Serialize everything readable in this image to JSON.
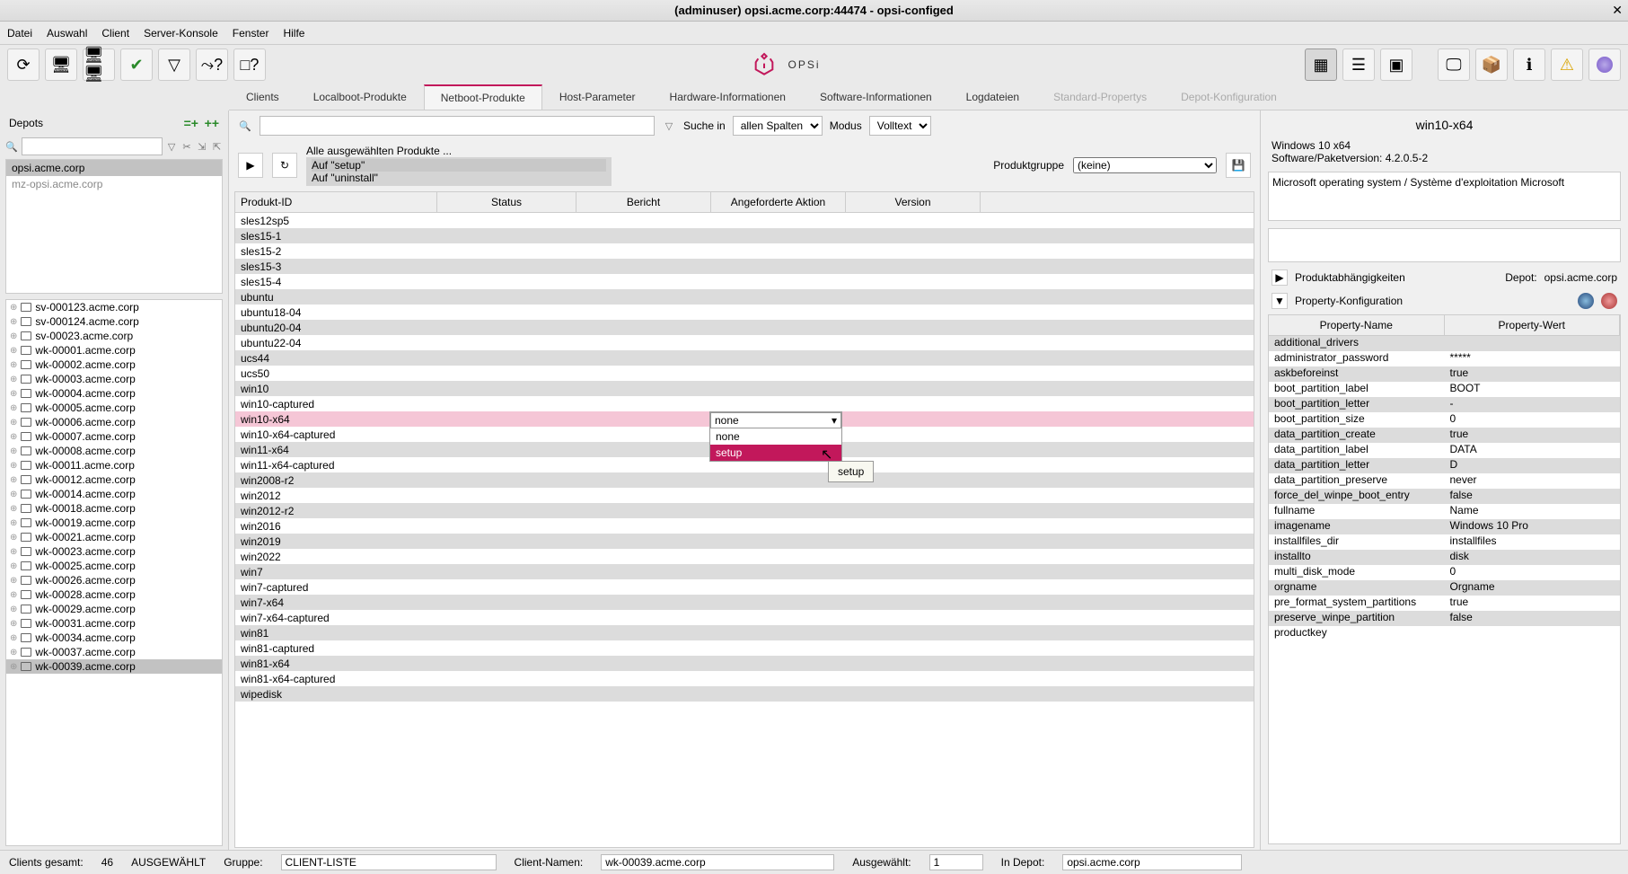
{
  "window_title": "(adminuser) opsi.acme.corp:44474 - opsi-configed",
  "menu": [
    "Datei",
    "Auswahl",
    "Client",
    "Server-Konsole",
    "Fenster",
    "Hilfe"
  ],
  "logo_text": "OPSi",
  "tabs": [
    {
      "label": "Clients",
      "active": false
    },
    {
      "label": "Localboot-Produkte",
      "active": false
    },
    {
      "label": "Netboot-Produkte",
      "active": true
    },
    {
      "label": "Host-Parameter",
      "active": false
    },
    {
      "label": "Hardware-Informationen",
      "active": false
    },
    {
      "label": "Software-Informationen",
      "active": false
    },
    {
      "label": "Logdateien",
      "active": false
    },
    {
      "label": "Standard-Propertys",
      "disabled": true
    },
    {
      "label": "Depot-Konfiguration",
      "disabled": true
    }
  ],
  "depots": {
    "label": "Depots",
    "items": [
      "opsi.acme.corp",
      "mz-opsi.acme.corp"
    ],
    "selected": 0
  },
  "clients": [
    "sv-000123.acme.corp",
    "sv-000124.acme.corp",
    "sv-00023.acme.corp",
    "wk-00001.acme.corp",
    "wk-00002.acme.corp",
    "wk-00003.acme.corp",
    "wk-00004.acme.corp",
    "wk-00005.acme.corp",
    "wk-00006.acme.corp",
    "wk-00007.acme.corp",
    "wk-00008.acme.corp",
    "wk-00011.acme.corp",
    "wk-00012.acme.corp",
    "wk-00014.acme.corp",
    "wk-00018.acme.corp",
    "wk-00019.acme.corp",
    "wk-00021.acme.corp",
    "wk-00023.acme.corp",
    "wk-00025.acme.corp",
    "wk-00026.acme.corp",
    "wk-00028.acme.corp",
    "wk-00029.acme.corp",
    "wk-00031.acme.corp",
    "wk-00034.acme.corp",
    "wk-00037.acme.corp",
    "wk-00039.acme.corp"
  ],
  "client_selected": 25,
  "search": {
    "suche_in": "Suche in",
    "spalten": "allen Spalten",
    "modus": "Modus",
    "modus_val": "Volltext"
  },
  "prodhead": {
    "all": "Alle ausgewählten Produkte ...",
    "setup": "Auf \"setup\"",
    "uninstall": "Auf \"uninstall\"",
    "pg": "Produktgruppe",
    "pg_val": "(keine)"
  },
  "cols": {
    "id": "Produkt-ID",
    "status": "Status",
    "bericht": "Bericht",
    "aktion": "Angeforderte Aktion",
    "version": "Version"
  },
  "rows": [
    "sles12sp5",
    "sles15-1",
    "sles15-2",
    "sles15-3",
    "sles15-4",
    "ubuntu",
    "ubuntu18-04",
    "ubuntu20-04",
    "ubuntu22-04",
    "ucs44",
    "ucs50",
    "win10",
    "win10-captured",
    "win10-x64",
    "win10-x64-captured",
    "win11-x64",
    "win11-x64-captured",
    "win2008-r2",
    "win2012",
    "win2012-r2",
    "win2016",
    "win2019",
    "win2022",
    "win7",
    "win7-captured",
    "win7-x64",
    "win7-x64-captured",
    "win81",
    "win81-captured",
    "win81-x64",
    "win81-x64-captured",
    "wipedisk"
  ],
  "row_selected": 13,
  "dropdown": {
    "current": "none",
    "opts": [
      "none",
      "setup"
    ],
    "hover": 1,
    "tooltip": "setup"
  },
  "right": {
    "title": "win10-x64",
    "name": "Windows 10 x64",
    "ver_label": "Software/Paketversion:",
    "ver": "4.2.0.5-2",
    "desc": "Microsoft operating system / Système d'exploitation Microsoft",
    "dep": "Produktabhängigkeiten",
    "depot_label": "Depot:",
    "depot": "opsi.acme.corp",
    "propconf": "Property-Konfiguration",
    "ph_name": "Property-Name",
    "ph_val": "Property-Wert",
    "props": [
      [
        "additional_drivers",
        ""
      ],
      [
        "administrator_password",
        "*****"
      ],
      [
        "askbeforeinst",
        "true"
      ],
      [
        "boot_partition_label",
        "BOOT"
      ],
      [
        "boot_partition_letter",
        "-"
      ],
      [
        "boot_partition_size",
        "0"
      ],
      [
        "data_partition_create",
        "true"
      ],
      [
        "data_partition_label",
        "DATA"
      ],
      [
        "data_partition_letter",
        "D"
      ],
      [
        "data_partition_preserve",
        "never"
      ],
      [
        "force_del_winpe_boot_entry",
        "false"
      ],
      [
        "fullname",
        "Name"
      ],
      [
        "imagename",
        "Windows 10 Pro"
      ],
      [
        "installfiles_dir",
        "installfiles"
      ],
      [
        "installto",
        "disk"
      ],
      [
        "multi_disk_mode",
        "0"
      ],
      [
        "orgname",
        "Orgname"
      ],
      [
        "pre_format_system_partitions",
        "true"
      ],
      [
        "preserve_winpe_partition",
        "false"
      ],
      [
        "productkey",
        ""
      ]
    ]
  },
  "status": {
    "gesamt_l": "Clients gesamt:",
    "gesamt": "46",
    "ausg": "AUSGEWÄHLT",
    "gruppe": "Gruppe:",
    "gruppe_v": "CLIENT-LISTE",
    "cn": "Client-Namen:",
    "cn_v": "wk-00039.acme.corp",
    "aw": "Ausgewählt:",
    "aw_v": "1",
    "dep": "In Depot:",
    "dep_v": "opsi.acme.corp"
  }
}
